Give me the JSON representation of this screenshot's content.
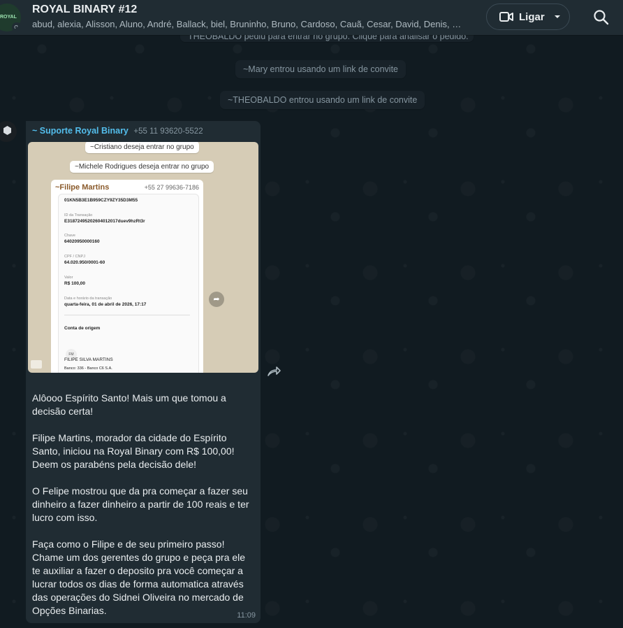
{
  "header": {
    "group_name": "ROYAL BINARY #12",
    "members": "abud, alexia, Alisson, Aluno, André, Ballack, biel, Bruninho, Bruno, Cardoso, Cauã, Cesar, David, Denis, DG, D…",
    "avatar_text": "ROYAL",
    "call_label": "Ligar"
  },
  "system_messages": {
    "partial": "THEOBALDO pediu para entrar no grupo. Clique para analisar o pedido.",
    "mary": "~Mary entrou usando um link de convite",
    "theobaldo": "~THEOBALDO entrou usando um link de convite"
  },
  "message": {
    "sender_name": "~ Suporte Royal Binary",
    "sender_phone": "+55 11 93620-5522",
    "time": "11:09",
    "image": {
      "sys1": "~Cristiano deseja entrar no grupo",
      "sys2": "~Michele Rodrigues deseja entrar no grupo",
      "forwarded_name": "~Filipe Martins",
      "forwarded_phone": "+55 27 99636-7186",
      "receipt": {
        "code": "01KN5B3E1B959CZY9ZY35D3M55",
        "id_label": "ID da Transação",
        "id_value": "E31872495202604012017duev9hzRt3r",
        "key_label": "Chave",
        "key_value": "64020950000160",
        "cpf_label": "CPF / CNPJ",
        "cpf_value": "64.020.950/0001-60",
        "value_label": "Valor",
        "value_value": "R$ 100,00",
        "date_label": "Data e horário da transação",
        "date_value": "quarta-feira, 01 de abril de 2026, 17:17",
        "origin_label": "Conta de origem",
        "avatar_initials": "FM",
        "holder_name": "FILIPE SILVA MARTINS",
        "bank": "Banco: 336 - Banco C6 S.A."
      }
    },
    "caption": "Alôooo Espírito Santo! Mais um que tomou a decisão certa!\n\nFilipe Martins, morador da cidade do Espírito Santo, iniciou na Royal Binary com R$ 100,00! Deem os parabéns pela decisão dele!\n\nO Felipe mostrou que da pra começar a fazer seu dinheiro a fazer dinheiro a partir de 100 reais e ter lucro com isso.\n\nFaça como o Filipe e de seu primeiro passo! Chame um dos gerentes do grupo e peça pra ele te auxiliar a fazer o deposito pra você começar a lucrar todos os dias de forma automatica através das operações do Sidnei Oliveira no mercado de Opções Binarias."
  }
}
